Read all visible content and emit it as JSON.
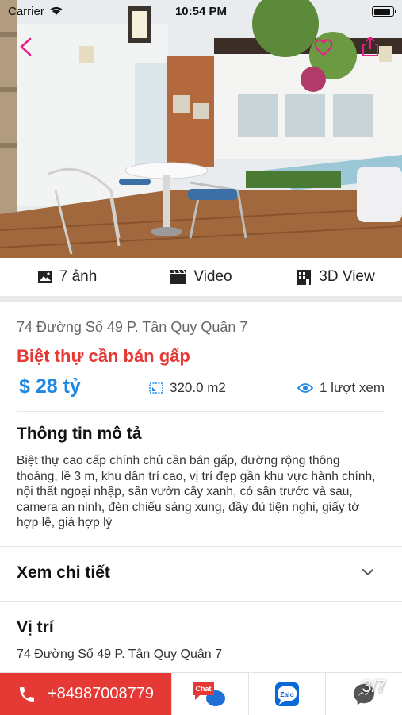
{
  "status_bar": {
    "carrier": "Carrier",
    "time": "10:54 PM"
  },
  "gallery": {
    "counter": "3/7"
  },
  "media_tabs": [
    {
      "label": "7 ảnh",
      "icon": "image-icon"
    },
    {
      "label": "Video",
      "icon": "video-icon"
    },
    {
      "label": "3D View",
      "icon": "3d-view-icon"
    }
  ],
  "listing": {
    "address": "74 Đường Số 49 P. Tân Quy Quận 7",
    "title": "Biệt thự cần bán gấp",
    "price": "$ 28 tỷ",
    "area": "320.0 m2",
    "views": "1 lượt xem"
  },
  "description": {
    "heading": "Thông tin mô tả",
    "text": "Biệt thự cao cấp chính chủ cần bán gấp, đường rộng thông thoáng, lề 3 m, khu dân trí cao, vị trí đẹp gần khu vực hành chính, nội thất ngoại nhập, sân vườn cây xanh, có sân trước và sau, camera an ninh, đèn chiếu sáng xung, đầy đủ tiện nghi, giấy tờ hợp lệ, giá hợp lý"
  },
  "details": {
    "heading": "Xem chi tiết"
  },
  "location": {
    "heading": "Vị trí",
    "address": "74 Đường Số 49 P. Tân Quy Quận 7"
  },
  "bottom_bar": {
    "phone": "+84987008779",
    "chat_label": "Chat",
    "zalo_label": "Zalo"
  },
  "colors": {
    "accent": "#e53935",
    "price": "#1e88e5",
    "pink": "#e91e8c",
    "messenger": "#555555"
  }
}
